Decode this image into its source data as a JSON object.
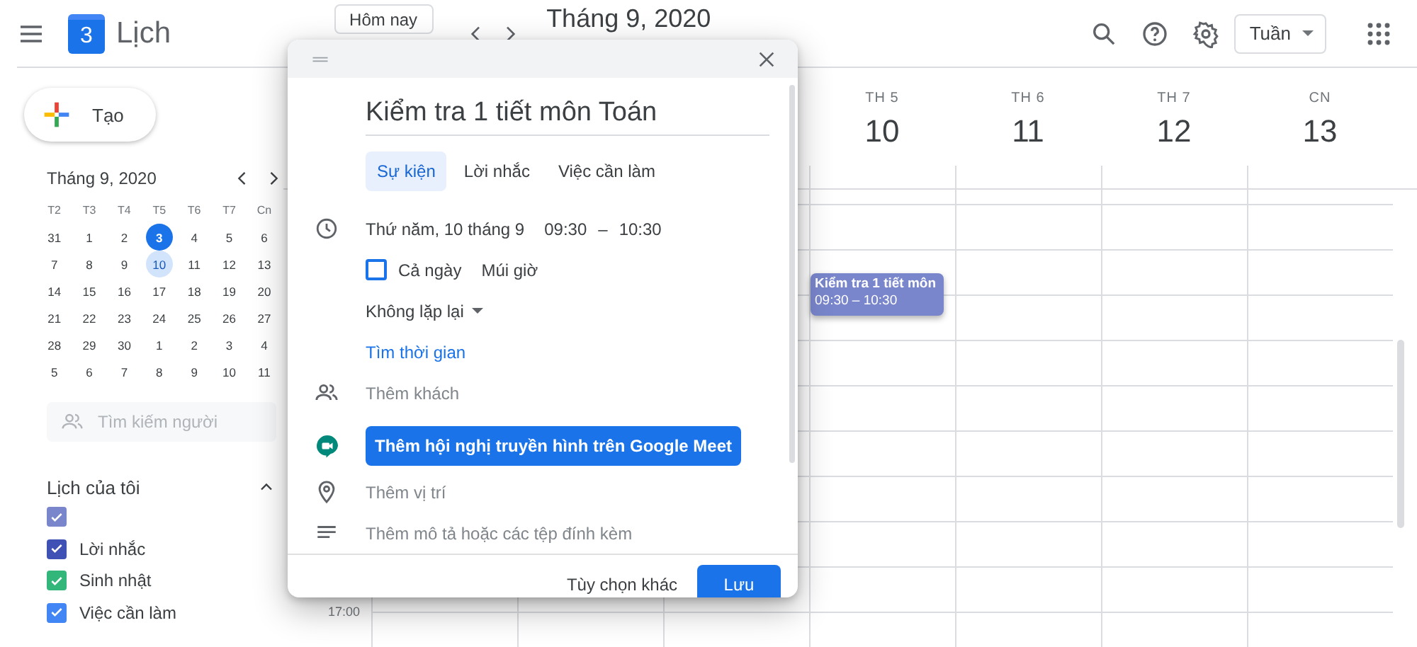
{
  "header": {
    "app_name": "Lịch",
    "logo_date": "3",
    "today_button": "Hôm nay",
    "period_title": "Tháng 9, 2020",
    "view_dropdown": "Tuần"
  },
  "sidebar": {
    "create_button": "Tạo",
    "mini_calendar": {
      "title": "Tháng 9, 2020",
      "weekdays": [
        "T2",
        "T3",
        "T4",
        "T5",
        "T6",
        "T7",
        "Cn"
      ],
      "weeks": [
        [
          {
            "label": "31",
            "today": false,
            "selected": false
          },
          {
            "label": "1",
            "today": false,
            "selected": false
          },
          {
            "label": "2",
            "today": false,
            "selected": false
          },
          {
            "label": "3",
            "today": true,
            "selected": false
          },
          {
            "label": "4",
            "today": false,
            "selected": false
          },
          {
            "label": "5",
            "today": false,
            "selected": false
          },
          {
            "label": "6",
            "today": false,
            "selected": false
          }
        ],
        [
          {
            "label": "7",
            "today": false,
            "selected": false
          },
          {
            "label": "8",
            "today": false,
            "selected": false
          },
          {
            "label": "9",
            "today": false,
            "selected": false
          },
          {
            "label": "10",
            "today": false,
            "selected": true
          },
          {
            "label": "11",
            "today": false,
            "selected": false
          },
          {
            "label": "12",
            "today": false,
            "selected": false
          },
          {
            "label": "13",
            "today": false,
            "selected": false
          }
        ],
        [
          {
            "label": "14",
            "today": false,
            "selected": false
          },
          {
            "label": "15",
            "today": false,
            "selected": false
          },
          {
            "label": "16",
            "today": false,
            "selected": false
          },
          {
            "label": "17",
            "today": false,
            "selected": false
          },
          {
            "label": "18",
            "today": false,
            "selected": false
          },
          {
            "label": "19",
            "today": false,
            "selected": false
          },
          {
            "label": "20",
            "today": false,
            "selected": false
          }
        ],
        [
          {
            "label": "21",
            "today": false,
            "selected": false
          },
          {
            "label": "22",
            "today": false,
            "selected": false
          },
          {
            "label": "23",
            "today": false,
            "selected": false
          },
          {
            "label": "24",
            "today": false,
            "selected": false
          },
          {
            "label": "25",
            "today": false,
            "selected": false
          },
          {
            "label": "26",
            "today": false,
            "selected": false
          },
          {
            "label": "27",
            "today": false,
            "selected": false
          }
        ],
        [
          {
            "label": "28",
            "today": false,
            "selected": false
          },
          {
            "label": "29",
            "today": false,
            "selected": false
          },
          {
            "label": "30",
            "today": false,
            "selected": false
          },
          {
            "label": "1",
            "today": false,
            "selected": false
          },
          {
            "label": "2",
            "today": false,
            "selected": false
          },
          {
            "label": "3",
            "today": false,
            "selected": false
          },
          {
            "label": "4",
            "today": false,
            "selected": false
          }
        ],
        [
          {
            "label": "5",
            "today": false,
            "selected": false
          },
          {
            "label": "6",
            "today": false,
            "selected": false
          },
          {
            "label": "7",
            "today": false,
            "selected": false
          },
          {
            "label": "8",
            "today": false,
            "selected": false
          },
          {
            "label": "9",
            "today": false,
            "selected": false
          },
          {
            "label": "10",
            "today": false,
            "selected": false
          },
          {
            "label": "11",
            "today": false,
            "selected": false
          }
        ]
      ]
    },
    "people_search": {
      "placeholder": "Tìm kiếm người"
    },
    "my_calendars": {
      "title": "Lịch của tôi",
      "expanded": true,
      "items": [
        {
          "checked": true,
          "color": "#7986cb"
        },
        {
          "label": "Lời nhắc",
          "checked": true,
          "color": "#3f51b5"
        },
        {
          "label": "Sinh nhật",
          "checked": true,
          "color": "#33b679"
        },
        {
          "label": "Việc cần làm",
          "checked": true,
          "color": "#4285f4"
        }
      ]
    }
  },
  "week_view": {
    "days": [
      {
        "weekday": "TH 5",
        "date": "10"
      },
      {
        "weekday": "TH 6",
        "date": "11"
      },
      {
        "weekday": "TH 7",
        "date": "12"
      },
      {
        "weekday": "CN",
        "date": "13"
      }
    ],
    "time_labels": [
      "17:00"
    ],
    "events": [
      {
        "title": "Kiểm tra 1 tiết môn",
        "time": "09:30 – 10:30",
        "color": "#7986cb"
      }
    ]
  },
  "event_dialog": {
    "title": "Kiểm tra 1 tiết môn Toán",
    "tabs": [
      {
        "label": "Sự kiện",
        "selected": true
      },
      {
        "label": "Lời nhắc",
        "selected": false
      },
      {
        "label": "Việc cần làm",
        "selected": false
      }
    ],
    "date": "Thứ năm, 10 tháng 9",
    "start_time": "09:30",
    "time_separator": "–",
    "end_time": "10:30",
    "all_day": {
      "label": "Cả ngày",
      "checked": false
    },
    "time_zone_link": "Múi giờ",
    "recurrence": "Không lặp lại",
    "find_time_link": "Tìm thời gian",
    "guests": {
      "placeholder": "Thêm khách"
    },
    "meet_button": "Thêm hội nghị truyền hình trên Google Meet",
    "location": {
      "placeholder": "Thêm vị trí"
    },
    "description": {
      "placeholder": "Thêm mô tả hoặc các tệp đính kèm"
    },
    "more_options_button": "Tùy chọn khác",
    "save_button": "Lưu"
  }
}
